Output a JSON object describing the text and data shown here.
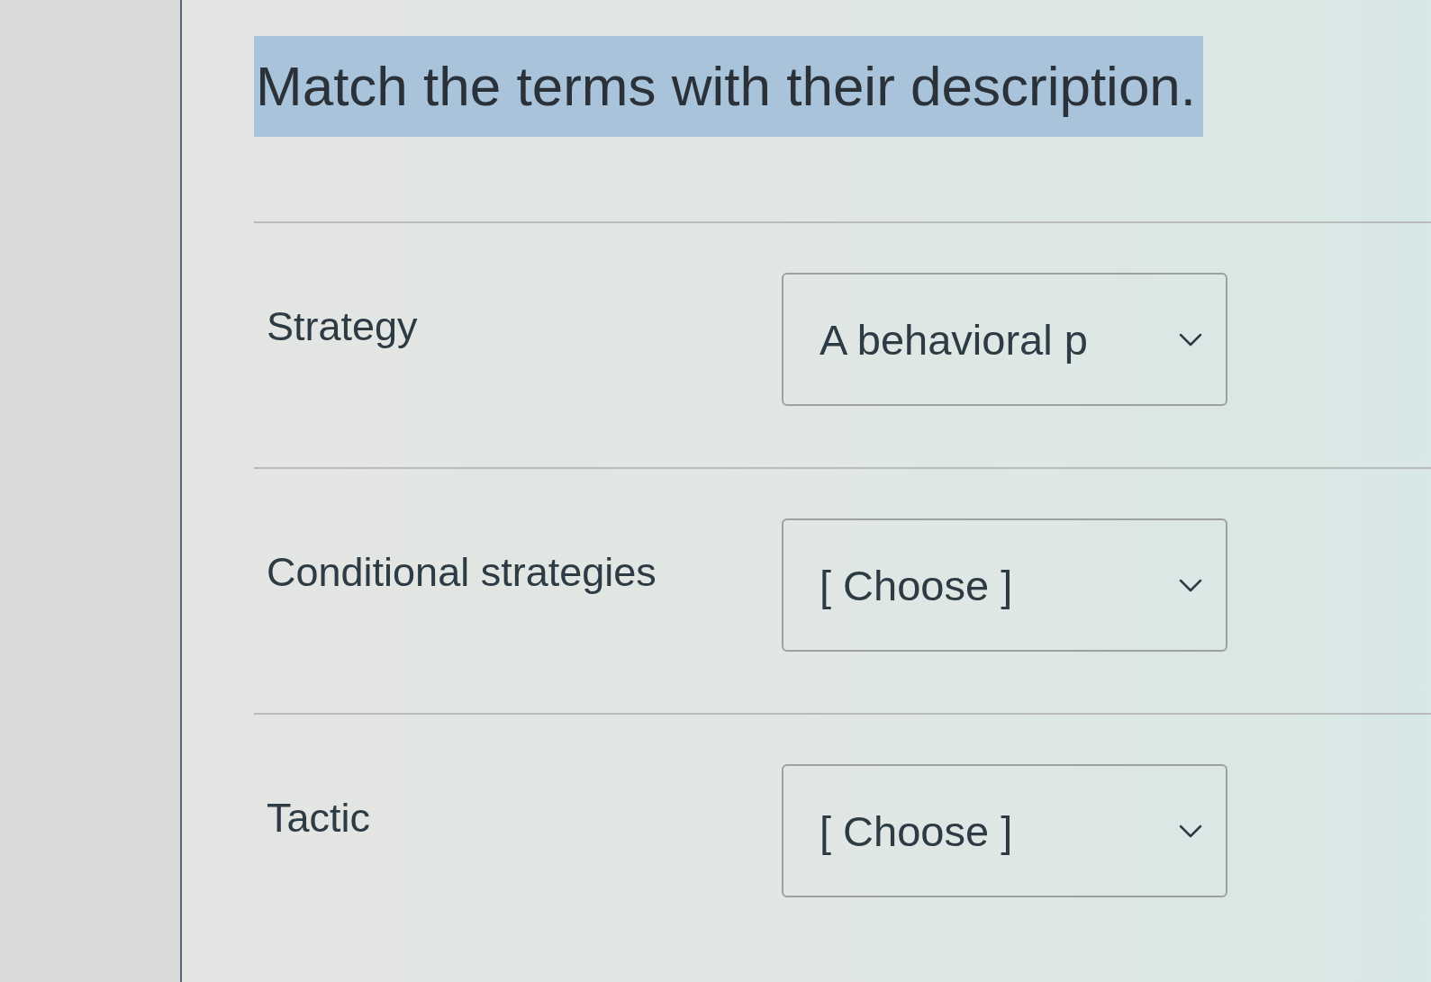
{
  "question": {
    "prompt": "Match the terms with their description.",
    "selected": true
  },
  "pairs": [
    {
      "term": "Strategy",
      "value": "A behavioral p"
    },
    {
      "term": "Conditional strategies",
      "placeholder": "[ Choose ]"
    },
    {
      "term": "Tactic",
      "placeholder": "[ Choose ]"
    }
  ]
}
